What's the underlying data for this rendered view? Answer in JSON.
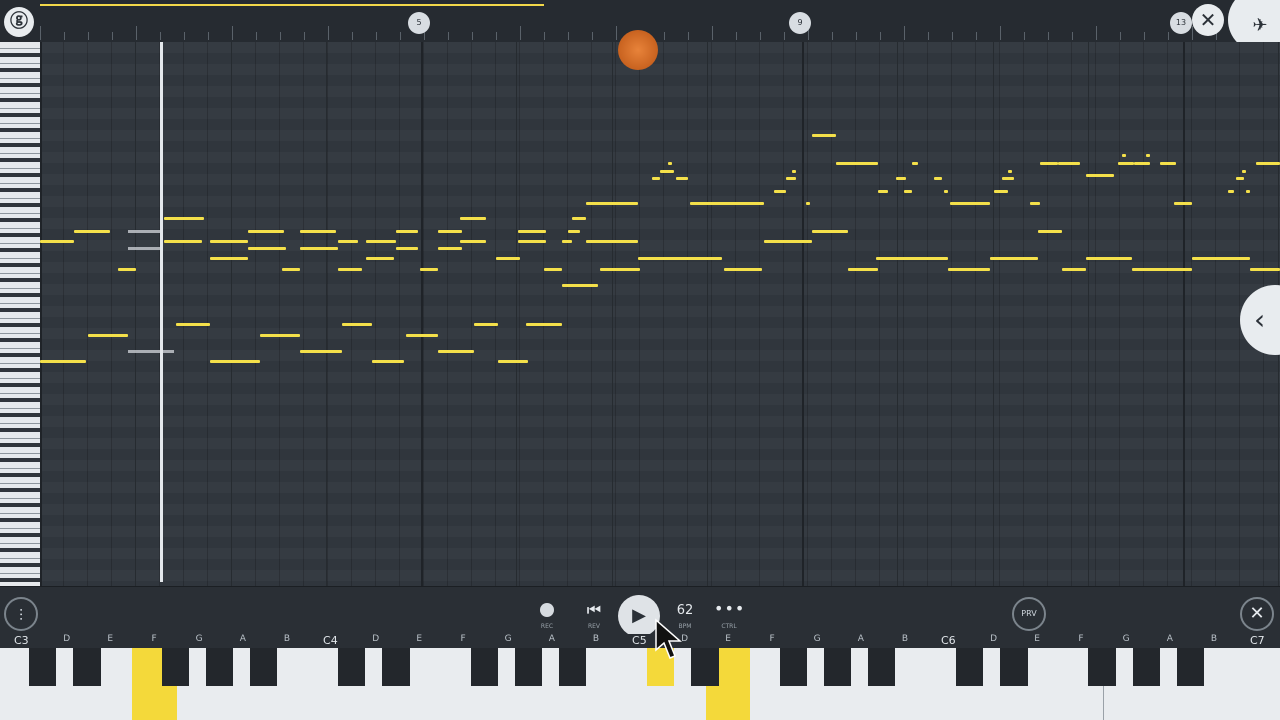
{
  "ruler": {
    "bar_markers": [
      "5",
      "9",
      "13"
    ]
  },
  "transport": {
    "rec_label": "REC",
    "rev_label": "REV",
    "bpm_value": "62",
    "bpm_label": "BPM",
    "ctrl_label": "CTRL",
    "prv_label": "PRV"
  },
  "keyboard": {
    "labels": [
      "C3",
      "D",
      "E",
      "F",
      "G",
      "A",
      "B",
      "C4",
      "D",
      "E",
      "F",
      "G",
      "A",
      "B",
      "C5",
      "D",
      "E",
      "F",
      "G",
      "A",
      "B",
      "C6",
      "D",
      "E",
      "F",
      "G",
      "A",
      "B",
      "C7"
    ],
    "highlighted_keys": [
      "F3",
      "C#5",
      "E5"
    ]
  },
  "icons": {
    "logo": "fl-logo-icon",
    "close": "close-icon",
    "side": "chevron-left-icon",
    "mixer": "mixer-icon",
    "rec": "record-icon",
    "rev": "skip-back-icon",
    "play": "play-icon",
    "ctrl": "more-icon"
  },
  "colors": {
    "note": "#f4e04a",
    "background": "#2b3138",
    "highlight_key": "#f4d93a"
  }
}
